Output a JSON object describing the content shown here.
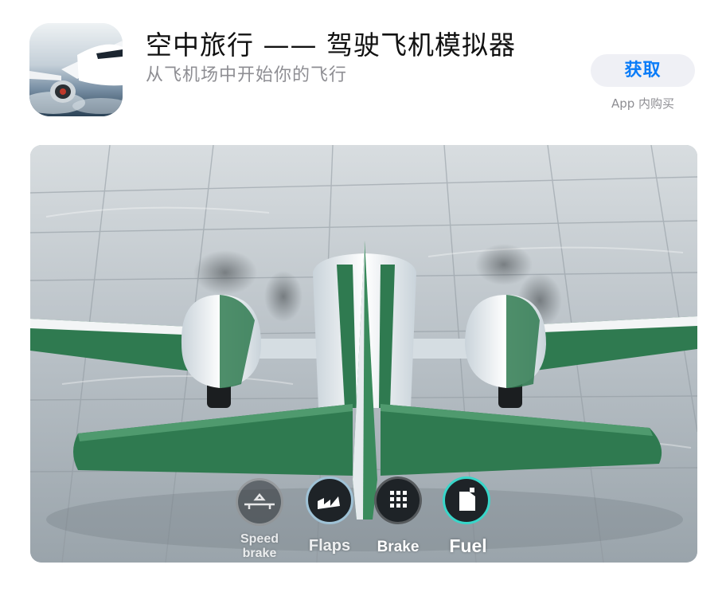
{
  "app": {
    "title": "空中旅行 —— 驾驶飞机模拟器",
    "subtitle": "从飞机场中开始你的飞行",
    "get_label": "获取",
    "iap_note": "App 内购买",
    "icon": "airplane-app-icon"
  },
  "hud": {
    "speed_brake": "Speed brake",
    "flaps": "Flaps",
    "brake": "Brake",
    "fuel": "Fuel"
  },
  "colors": {
    "accent": "#0a7cf8",
    "plane_green": "#2e7d4f",
    "fuel_ring": "#38d6c9"
  }
}
